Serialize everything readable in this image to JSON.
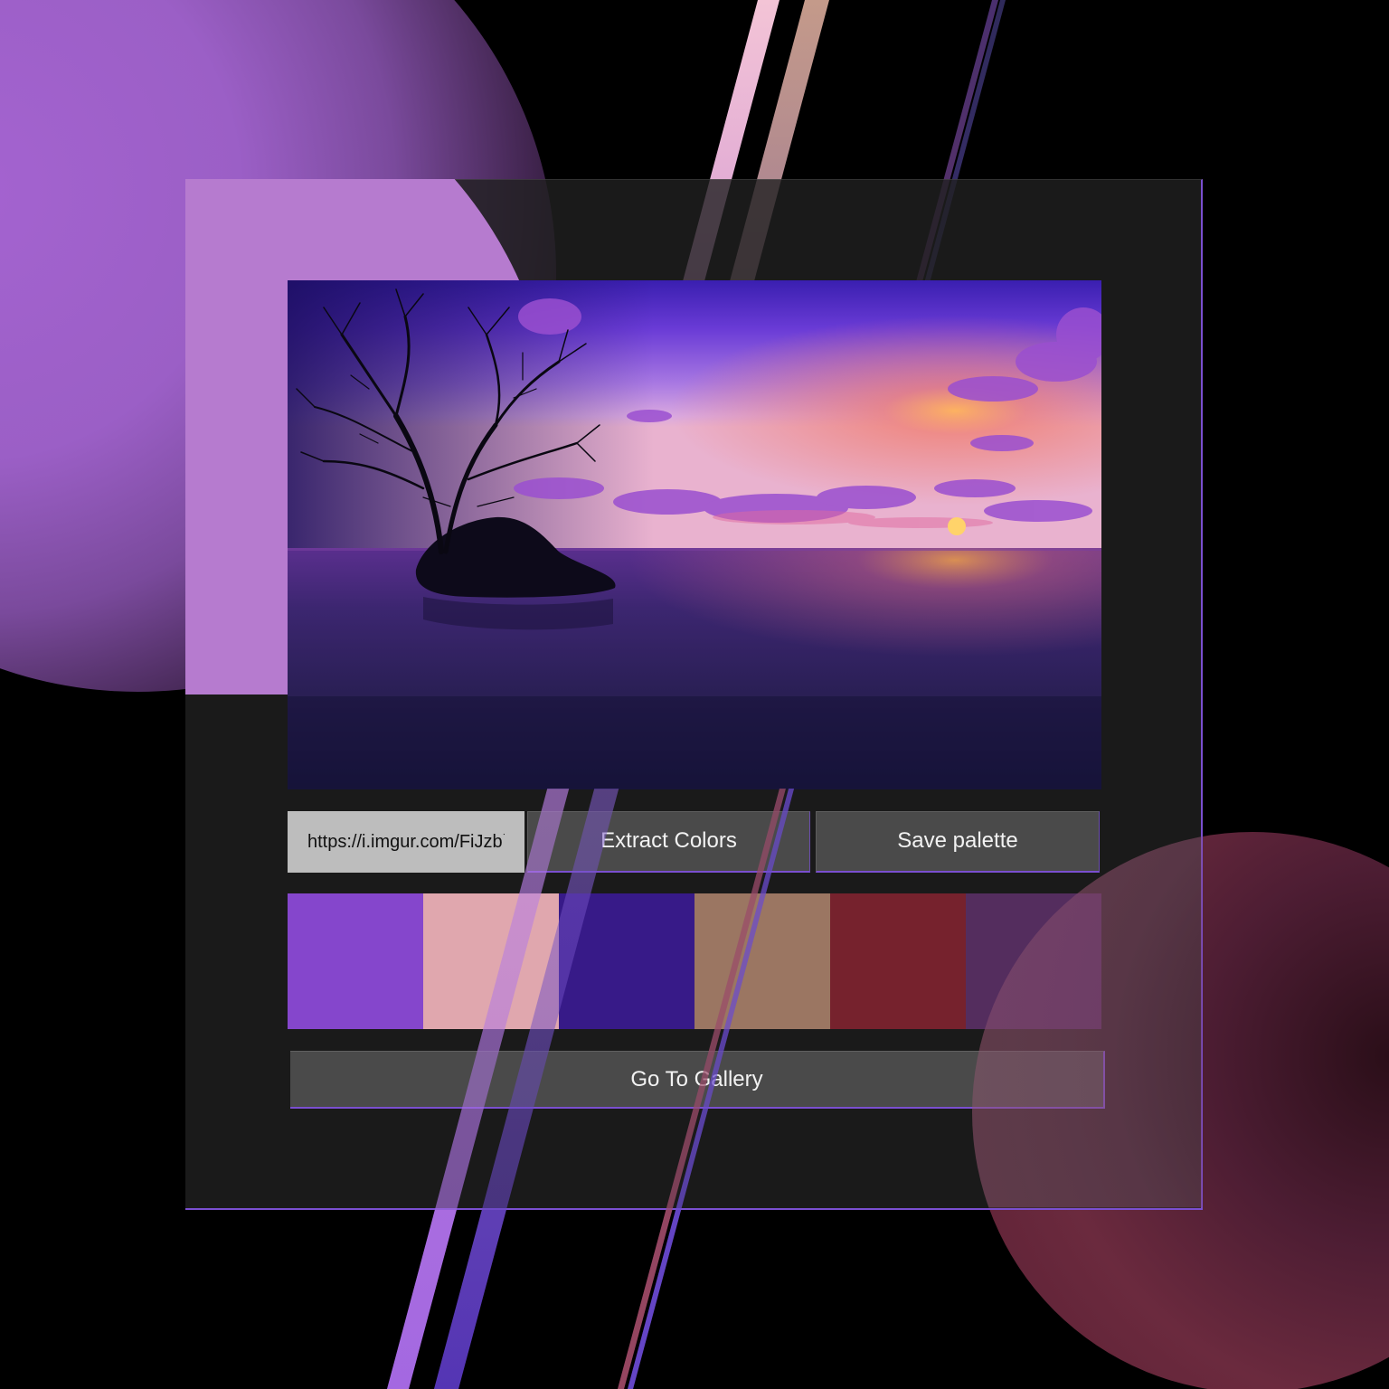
{
  "url_input": {
    "value": "https://i.imgur.com/FiJzb`",
    "placeholder": ""
  },
  "buttons": {
    "extract_label": "Extract Colors",
    "save_label": "Save palette",
    "gallery_label": "Go To Gallery"
  },
  "palette": {
    "colors": [
      "#8546cc",
      "#e0a7ae",
      "#371a88",
      "#9b7662",
      "#76222d",
      "#542d5e"
    ]
  },
  "theme": {
    "accent": "#7a4fd0",
    "panel": "#202020",
    "button": "#4e4e4e"
  }
}
